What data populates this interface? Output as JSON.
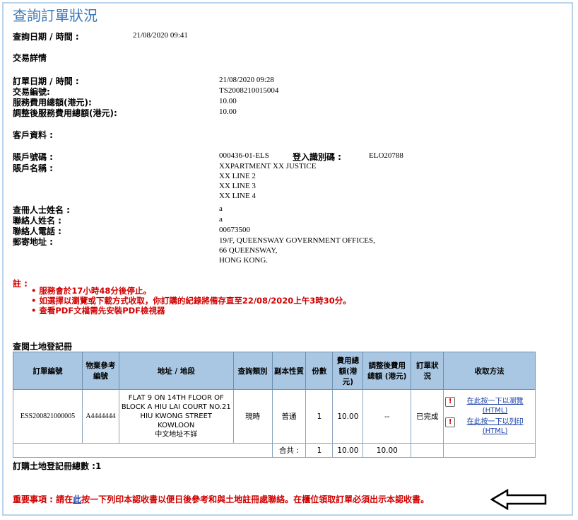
{
  "page": {
    "title": "查詢訂單狀況"
  },
  "query": {
    "label": "查詢日期 / 時間 :",
    "value": "21/08/2020 09:41"
  },
  "transaction": {
    "heading": "交易詳情",
    "rows": [
      {
        "label": "訂單日期 / 時間 :",
        "value": "21/08/2020 09:28"
      },
      {
        "label": "交易編號:",
        "value": "TS2008210015004"
      },
      {
        "label": "服務費用總額(港元):",
        "value": "10.00"
      },
      {
        "label": "調整後服務費用總額(港元):",
        "value": "10.00"
      }
    ]
  },
  "customer": {
    "heading": "客戶資料 :",
    "account_no_label": "賬戶號碼 :",
    "account_no": "000436-01-ELS",
    "login_label": "登入識別碼 :",
    "login_id": "ELO20788",
    "account_name_label": "賬戶名稱 :",
    "account_name_lines": [
      "XXPARTMENT XX JUSTICE",
      "XX LINE 2",
      "XX LINE 3",
      "XX LINE 4"
    ],
    "searcher_label": "查冊人士姓名 :",
    "searcher": "a",
    "contact_label": "聯絡人姓名 :",
    "contact": "a",
    "phone_label": "聯絡人電話 :",
    "phone": "00673500",
    "address_label": "郵寄地址 :",
    "address_lines": [
      "19/F, QUEENSWAY GOVERNMENT OFFICES,",
      "66 QUEENSWAY,",
      "HONG KONG."
    ]
  },
  "notes": {
    "title": "註 :",
    "items": [
      "服務會於17小時48分後停止。",
      "如選擇以瀏覽或下載方式收取，你訂購的紀錄將備存直至22/08/2020上午3時30分。",
      "查看PDF文檔需先安裝PDF檢視器"
    ]
  },
  "records": {
    "heading": "查閱土地登記冊",
    "columns": [
      "訂單編號",
      "物業參考編號",
      "地址 / 地段",
      "查詢類別",
      "副本性質",
      "份數",
      "費用總額(港元)",
      "調整後費用總額 (港元)",
      "訂單狀況",
      "收取方法"
    ],
    "rows": [
      {
        "order_no": "ESS200821000005",
        "property_ref": "A4444444",
        "address_lines": [
          "FLAT 9 ON 14TH FLOOR OF",
          "BLOCK A HIU LAI COURT NO.21",
          "HIU KWONG STREET KOWLOON",
          "中文地址不詳"
        ],
        "search_type": "現時",
        "copy_type": "普通",
        "copies": "1",
        "fee": "10.00",
        "adjusted_fee": "--",
        "status": "已完成",
        "methods": [
          "在此按一下以瀏覽 (HTML)",
          "在此按一下以列印 (HTML)"
        ]
      }
    ],
    "total_label": "合共 :",
    "total_copies": "1",
    "total_fee": "10.00",
    "total_adjusted": "10.00",
    "count_label": "訂購土地登記冊總數 :1"
  },
  "important": {
    "prefix": "重要事項 : 請在",
    "link": "此",
    "suffix": "按一下列印本認收書以便日後參考和與土地註冊處聯絡。在櫃位領取訂單必須出示本認收書。"
  }
}
